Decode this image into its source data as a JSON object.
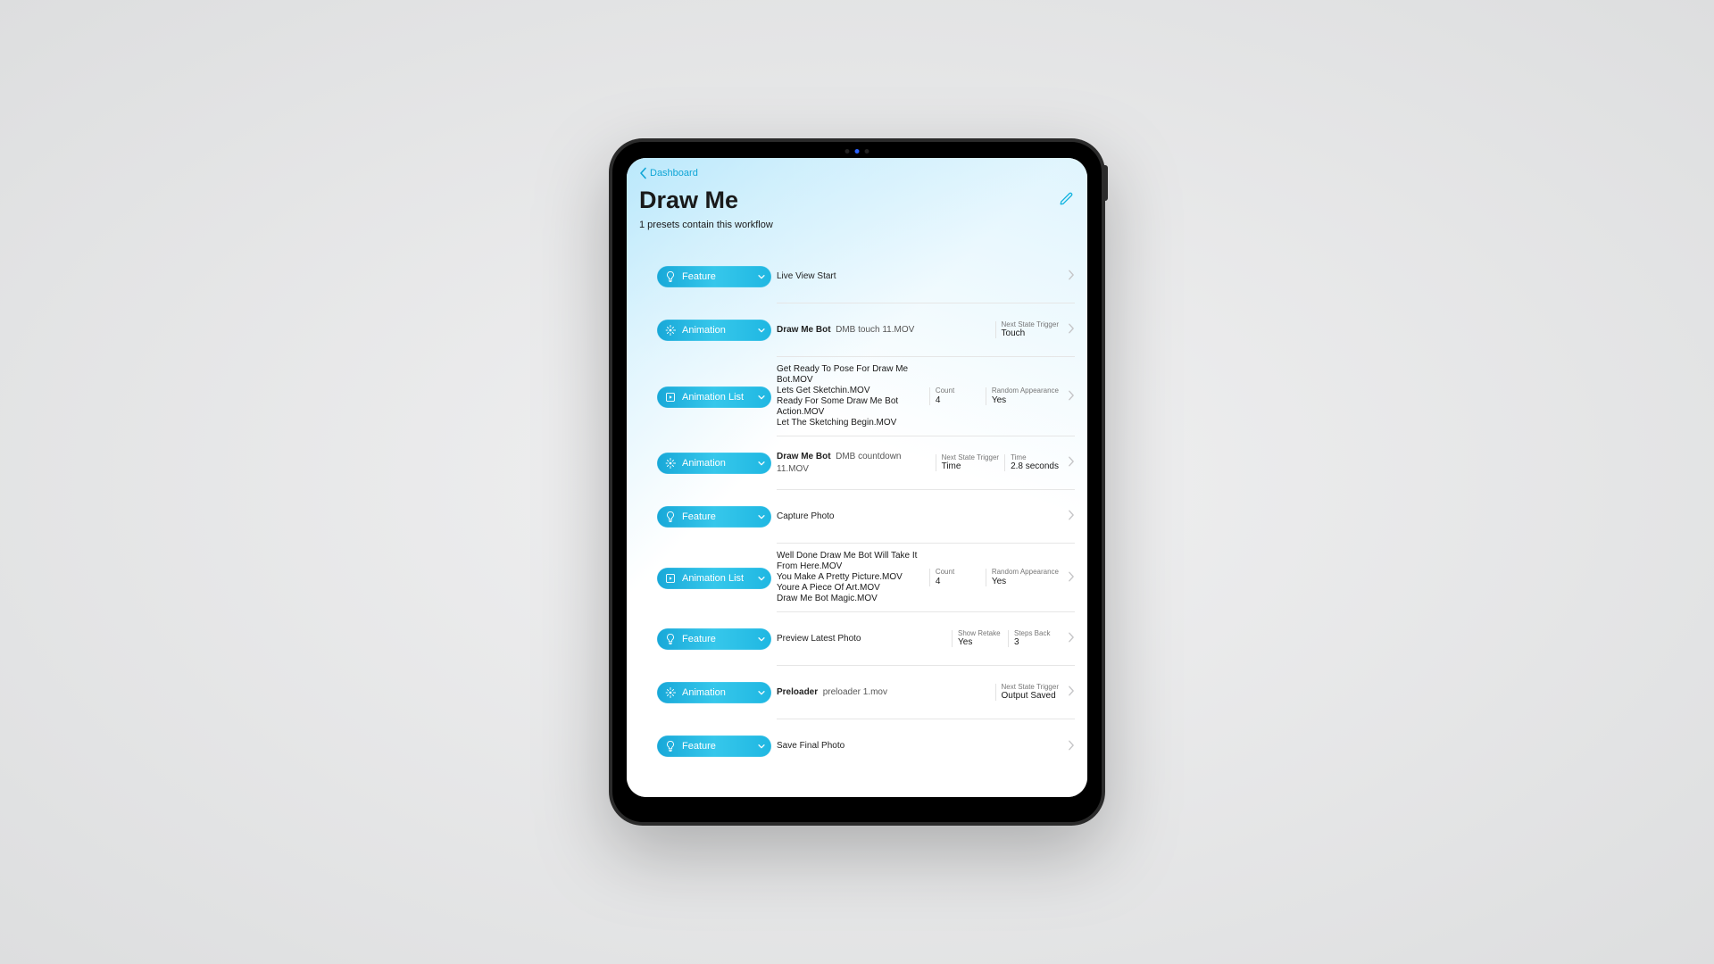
{
  "nav": {
    "back": "Dashboard"
  },
  "header": {
    "title": "Draw Me",
    "subtitle": "1 presets contain this workflow"
  },
  "pill_types": {
    "feature": "Feature",
    "animation": "Animation",
    "animlist": "Animation List"
  },
  "meta_labels": {
    "next_state": "Next State Trigger",
    "time": "Time",
    "count": "Count",
    "random_appearance": "Random Appearance",
    "show_retake": "Show Retake",
    "steps_back": "Steps Back"
  },
  "steps": [
    {
      "type": "feature",
      "title": "Live View Start"
    },
    {
      "type": "animation",
      "title_strong": "Draw Me Bot",
      "title_sub": "DMB touch 11.MOV",
      "metas": [
        {
          "k": "next_state",
          "v": "Touch"
        }
      ]
    },
    {
      "type": "animlist",
      "files": [
        "Get Ready To Pose For Draw Me Bot.MOV",
        "Lets Get Sketchin.MOV",
        "Ready For Some Draw Me Bot Action.MOV",
        "Let The Sketching Begin.MOV"
      ],
      "metas": [
        {
          "k": "count",
          "v": "4"
        },
        {
          "k": "random_appearance",
          "v": "Yes"
        }
      ]
    },
    {
      "type": "animation",
      "title_strong": "Draw Me Bot",
      "title_sub": "DMB countdown 11.MOV",
      "metas": [
        {
          "k": "next_state",
          "v": "Time"
        },
        {
          "k": "time",
          "v": "2.8 seconds"
        }
      ]
    },
    {
      "type": "feature",
      "title": "Capture Photo"
    },
    {
      "type": "animlist",
      "files": [
        "Well Done Draw Me Bot Will Take It From Here.MOV",
        "You Make A Pretty Picture.MOV",
        "Youre A Piece Of Art.MOV",
        "Draw Me Bot Magic.MOV"
      ],
      "metas": [
        {
          "k": "count",
          "v": "4"
        },
        {
          "k": "random_appearance",
          "v": "Yes"
        }
      ]
    },
    {
      "type": "feature",
      "title": "Preview Latest Photo",
      "metas": [
        {
          "k": "show_retake",
          "v": "Yes"
        },
        {
          "k": "steps_back",
          "v": "3"
        }
      ]
    },
    {
      "type": "animation",
      "title_strong": "Preloader",
      "title_sub": "preloader 1.mov",
      "metas": [
        {
          "k": "next_state",
          "v": "Output Saved"
        }
      ]
    },
    {
      "type": "feature",
      "title": "Save Final Photo"
    }
  ]
}
